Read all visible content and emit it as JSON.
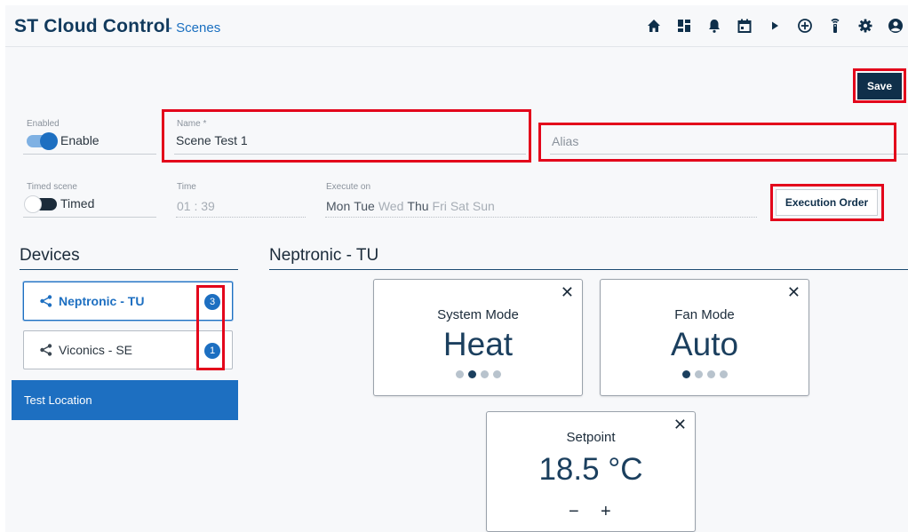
{
  "app": {
    "brand": "ST Cloud Control",
    "subtitle": "- Scenes"
  },
  "toolbar": {
    "icons": [
      "home-icon",
      "dashboard-icon",
      "bell-icon",
      "calendar-icon",
      "play-icon",
      "add-circle-icon",
      "remote-icon",
      "gear-icon",
      "account-icon"
    ],
    "save_label": "Save"
  },
  "form": {
    "enabled_label": "Enabled",
    "enable_text": "Enable",
    "enabled": true,
    "name_label": "Name *",
    "name_value": "Scene Test 1",
    "alias_placeholder": "Alias",
    "timed_label": "Timed scene",
    "timed_text": "Timed",
    "timed": false,
    "time_label": "Time",
    "time_value": "01 : 39",
    "execute_label": "Execute on",
    "days": [
      {
        "name": "Mon",
        "on": true
      },
      {
        "name": "Tue",
        "on": true
      },
      {
        "name": "Wed",
        "on": false
      },
      {
        "name": "Thu",
        "on": true
      },
      {
        "name": "Fri",
        "on": false
      },
      {
        "name": "Sat",
        "on": false
      },
      {
        "name": "Sun",
        "on": false
      }
    ],
    "execution_order_label": "Execution Order"
  },
  "devices": {
    "title": "Devices",
    "items": [
      {
        "label": "Neptronic - TU",
        "count": "3",
        "active": true
      },
      {
        "label": "Viconics - SE",
        "count": "1",
        "active": false
      }
    ],
    "location": "Test Location"
  },
  "panel": {
    "title": "Neptronic - TU",
    "cards": {
      "system_mode": {
        "title": "System Mode",
        "value": "Heat",
        "page": 2,
        "pages": 4
      },
      "fan_mode": {
        "title": "Fan Mode",
        "value": "Auto",
        "page": 1,
        "pages": 4
      },
      "setpoint": {
        "title": "Setpoint",
        "value": "18.5 °C",
        "minus": "−",
        "plus": "+"
      }
    },
    "close_glyph": "✕"
  },
  "colors": {
    "accent": "#1d6fc1",
    "navy": "#0f2f4a",
    "highlight": "#e3051b"
  }
}
